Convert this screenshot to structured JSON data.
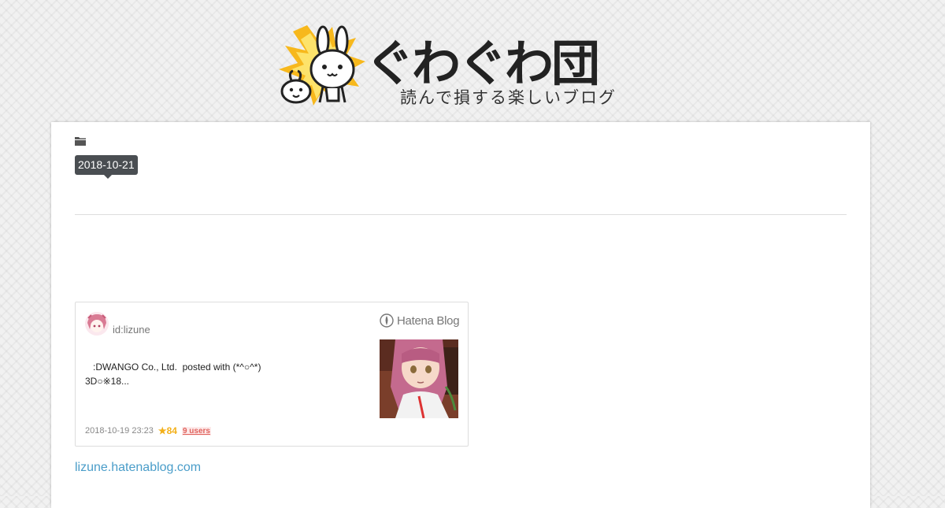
{
  "header": {
    "title": "ぐわぐわ団",
    "tagline": "読んで損する楽しいブログ",
    "logo_icon": "rabbit-mascot-icon"
  },
  "post": {
    "category_icon": "folder-icon",
    "date": "2018-10-21"
  },
  "embed": {
    "author": "id:lizune",
    "brand": "Hatena Blog",
    "excerpt_line1": "   :DWANGO Co., Ltd.  posted with (*^○^*)",
    "excerpt_line2": "3D○※18...",
    "datetime": "2018-10-19 23:23",
    "stars": "★84",
    "users": "9 users",
    "thumbnail_icon": "anime-girl-thumbnail",
    "avatar_icon": "anime-avatar-icon"
  },
  "link": {
    "text": "lizune.hatenablog.com"
  },
  "colors": {
    "badge_bg": "#4a4e52",
    "link": "#4a9dc9",
    "star": "#f3b019",
    "users": "#e0635d",
    "mascot_burst": "#f7b81c"
  }
}
